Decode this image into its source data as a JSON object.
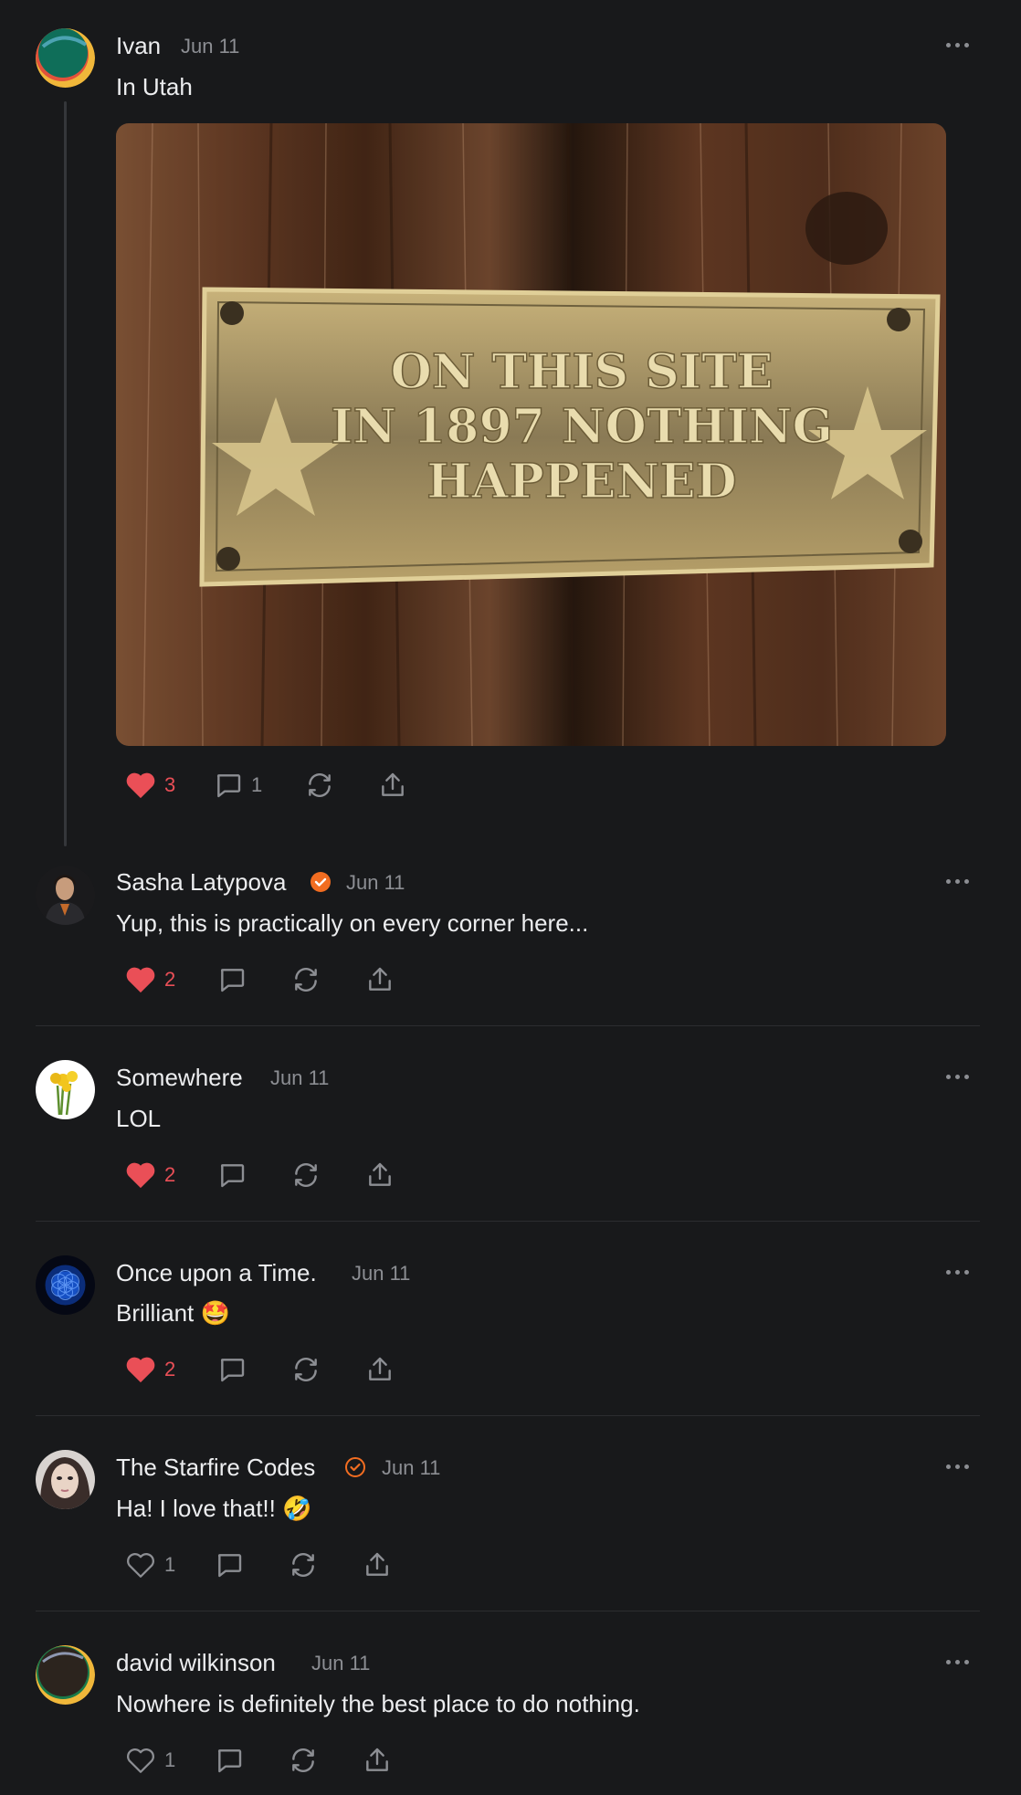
{
  "colors": {
    "background": "#18191b",
    "accent_like": "#ea4f57",
    "verified": "#f26d21",
    "muted": "#8c8e93"
  },
  "posts": [
    {
      "author": "Ivan",
      "date": "Jun 11",
      "text": "In Utah",
      "image": {
        "sign_lines": [
          "ON THIS SITE",
          "IN 1897 NOTHING",
          "HAPPENED"
        ]
      },
      "likes": "3",
      "comments": "1",
      "liked": true
    },
    {
      "author": "Sasha Latypova",
      "verified": true,
      "date": "Jun 11",
      "text": "Yup, this is practically on every corner here...",
      "likes": "2",
      "liked": true
    },
    {
      "author": "Somewhere",
      "date": "Jun 11",
      "text": "LOL",
      "likes": "2",
      "liked": true
    },
    {
      "author": "Once upon a Time.",
      "date": "Jun 11",
      "text": "Brilliant 🤩",
      "likes": "2",
      "liked": true
    },
    {
      "author": "The Starfire Codes",
      "verified": true,
      "date": "Jun 11",
      "text": "Ha! I love that!! 🤣",
      "likes": "1",
      "liked": false
    },
    {
      "author": "david wilkinson",
      "date": "Jun 11",
      "text": "Nowhere is definitely the best place to do nothing.",
      "likes": "1",
      "liked": false
    }
  ],
  "icons": {
    "like": "heart-icon",
    "comment": "comment-bubble-icon",
    "restack": "restack-icon",
    "share": "share-icon",
    "more": "more-dots-icon",
    "verified": "verified-check-icon"
  }
}
